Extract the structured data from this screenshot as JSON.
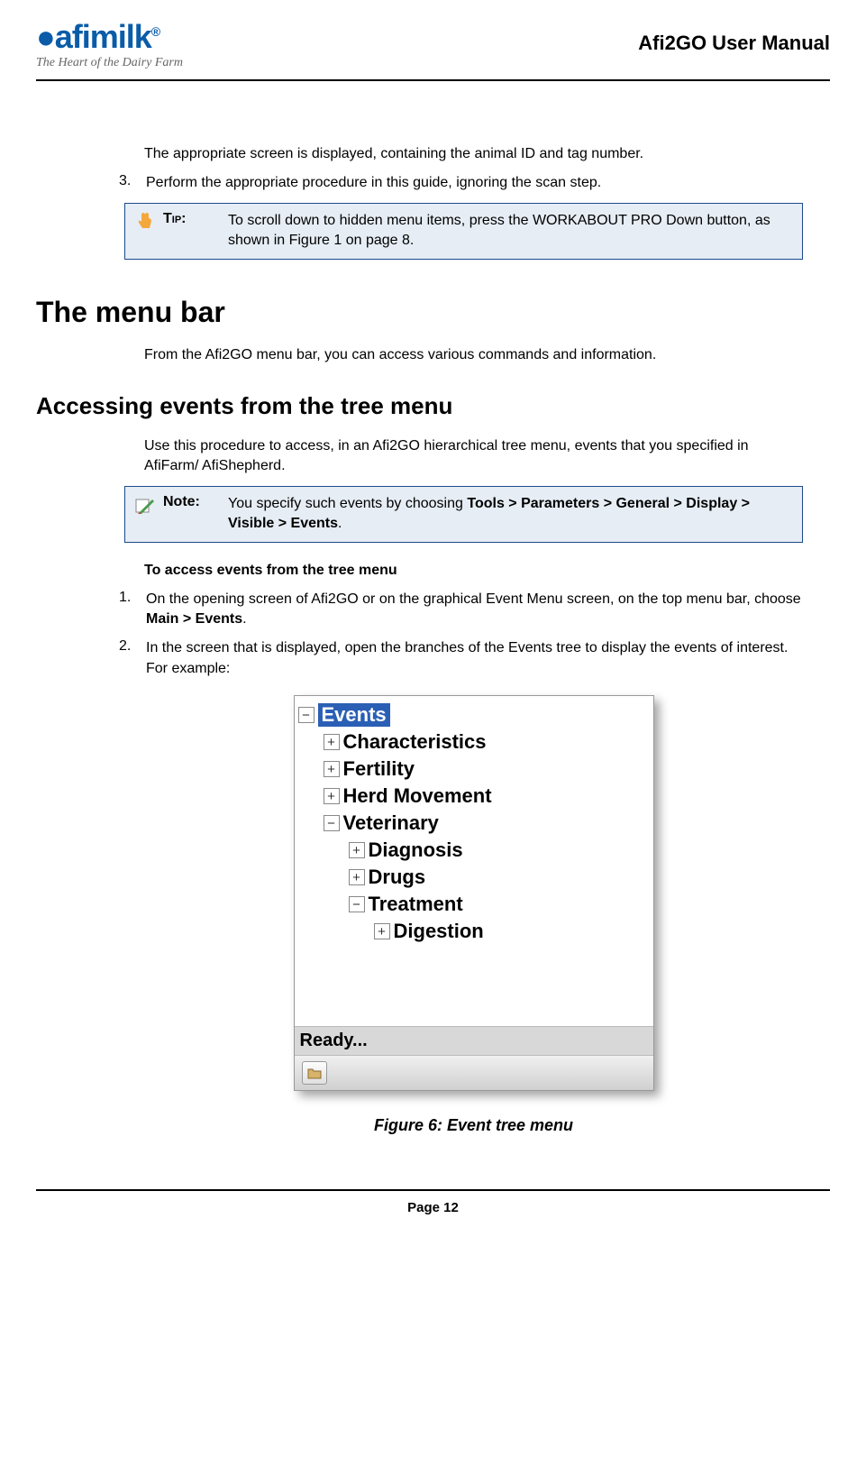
{
  "header": {
    "logo_name": "afimilk",
    "logo_tagline": "The Heart of the Dairy Farm",
    "doc_title": "Afi2GO User Manual"
  },
  "intro_para": "The appropriate screen is displayed, containing the animal ID and tag number.",
  "step3": {
    "num": "3.",
    "text": "Perform the appropriate procedure in this guide, ignoring the scan step."
  },
  "tip": {
    "label": "Tip:",
    "text": "To scroll down to hidden menu items, press the WORKABOUT PRO Down button, as shown in Figure 1 on page 8."
  },
  "h1": "The menu bar",
  "h1_para": "From the Afi2GO menu bar, you can access various commands and information.",
  "h2": "Accessing events from the tree menu",
  "h2_para": "Use this procedure to access, in an Afi2GO hierarchical tree menu, events that you specified in AfiFarm/ AfiShepherd.",
  "note": {
    "label": "Note:",
    "text_prefix": "You specify such events by choosing ",
    "text_bold": "Tools > Parameters > General > Display > Visible > Events",
    "text_suffix": "."
  },
  "procedure_lead": "To access events from the tree menu",
  "step1": {
    "num": "1.",
    "prefix": "On the opening screen of Afi2GO or on the graphical Event Menu screen, on the top menu bar, choose ",
    "bold": "Main > Events",
    "suffix": "."
  },
  "step2": {
    "num": "2.",
    "text": "In the screen that is displayed, open the branches of the Events tree to display the events of interest.  For example:"
  },
  "tree": {
    "root": {
      "expander": "−",
      "label": "Events",
      "selected": true,
      "level": 0
    },
    "items": [
      {
        "expander": "+",
        "label": "Characteristics",
        "level": 1
      },
      {
        "expander": "+",
        "label": "Fertility",
        "level": 1
      },
      {
        "expander": "+",
        "label": "Herd Movement",
        "level": 1
      },
      {
        "expander": "−",
        "label": "Veterinary",
        "level": 1
      },
      {
        "expander": "+",
        "label": "Diagnosis",
        "level": 2
      },
      {
        "expander": "+",
        "label": "Drugs",
        "level": 2
      },
      {
        "expander": "−",
        "label": "Treatment",
        "level": 2
      },
      {
        "expander": "+",
        "label": "Digestion",
        "level": 3
      }
    ],
    "status": "Ready..."
  },
  "caption": "Figure 6: Event tree menu",
  "footer": "Page 12"
}
